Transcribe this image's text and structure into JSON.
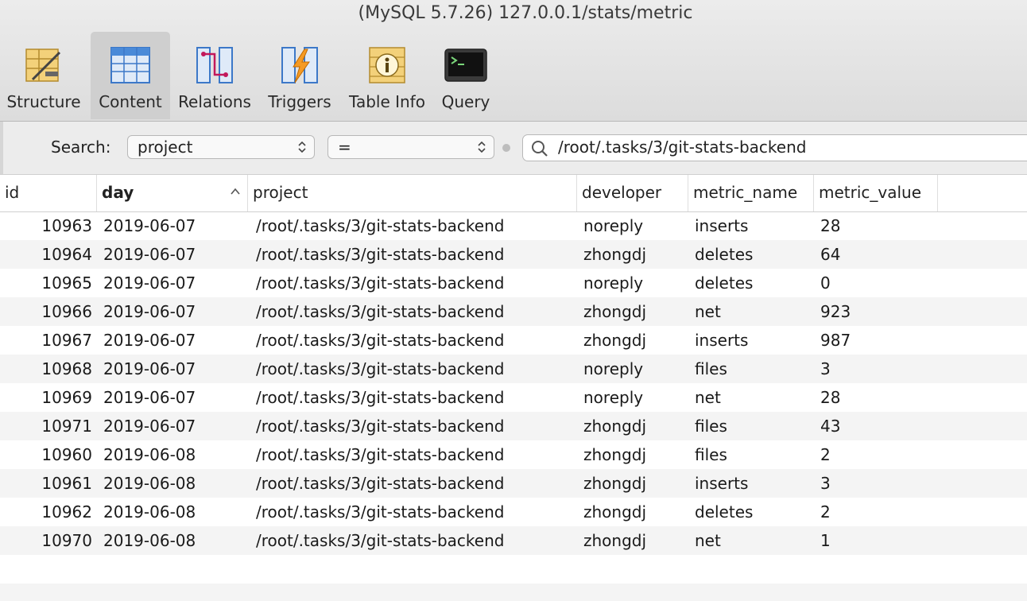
{
  "window": {
    "title": "(MySQL 5.7.26) 127.0.0.1/stats/metric"
  },
  "toolbar": {
    "items": [
      {
        "label": "Structure",
        "icon": "structure-icon",
        "selected": false
      },
      {
        "label": "Content",
        "icon": "content-icon",
        "selected": true
      },
      {
        "label": "Relations",
        "icon": "relations-icon",
        "selected": false
      },
      {
        "label": "Triggers",
        "icon": "triggers-icon",
        "selected": false
      },
      {
        "label": "Table Info",
        "icon": "table-info-icon",
        "selected": false
      },
      {
        "label": "Query",
        "icon": "query-icon",
        "selected": false
      }
    ]
  },
  "search": {
    "label": "Search:",
    "field": "project",
    "operator": "=",
    "value": "/root/.tasks/3/git-stats-backend"
  },
  "table": {
    "columns": [
      "id",
      "day",
      "project",
      "developer",
      "metric_name",
      "metric_value"
    ],
    "sorted_column": "day",
    "sort_direction": "ascending",
    "rows": [
      [
        "10963",
        "2019-06-07",
        "/root/.tasks/3/git-stats-backend",
        "noreply",
        "inserts",
        "28"
      ],
      [
        "10964",
        "2019-06-07",
        "/root/.tasks/3/git-stats-backend",
        "zhongdj",
        "deletes",
        "64"
      ],
      [
        "10965",
        "2019-06-07",
        "/root/.tasks/3/git-stats-backend",
        "noreply",
        "deletes",
        "0"
      ],
      [
        "10966",
        "2019-06-07",
        "/root/.tasks/3/git-stats-backend",
        "zhongdj",
        "net",
        "923"
      ],
      [
        "10967",
        "2019-06-07",
        "/root/.tasks/3/git-stats-backend",
        "zhongdj",
        "inserts",
        "987"
      ],
      [
        "10968",
        "2019-06-07",
        "/root/.tasks/3/git-stats-backend",
        "noreply",
        "files",
        "3"
      ],
      [
        "10969",
        "2019-06-07",
        "/root/.tasks/3/git-stats-backend",
        "noreply",
        "net",
        "28"
      ],
      [
        "10971",
        "2019-06-07",
        "/root/.tasks/3/git-stats-backend",
        "zhongdj",
        "files",
        "43"
      ],
      [
        "10960",
        "2019-06-08",
        "/root/.tasks/3/git-stats-backend",
        "zhongdj",
        "files",
        "2"
      ],
      [
        "10961",
        "2019-06-08",
        "/root/.tasks/3/git-stats-backend",
        "zhongdj",
        "inserts",
        "3"
      ],
      [
        "10962",
        "2019-06-08",
        "/root/.tasks/3/git-stats-backend",
        "zhongdj",
        "deletes",
        "2"
      ],
      [
        "10970",
        "2019-06-08",
        "/root/.tasks/3/git-stats-backend",
        "zhongdj",
        "net",
        "1"
      ]
    ]
  }
}
